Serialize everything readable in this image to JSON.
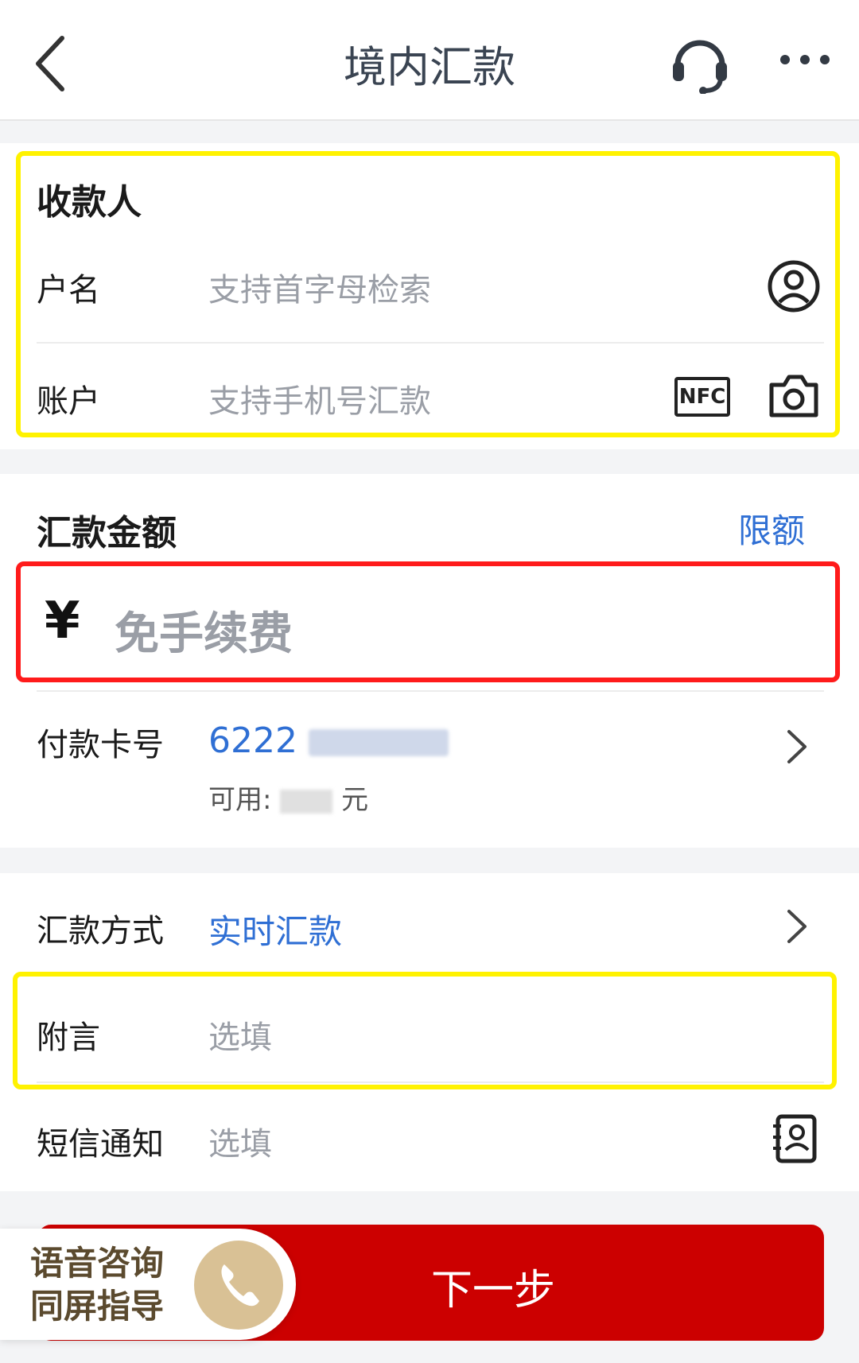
{
  "header": {
    "title": "境内汇款"
  },
  "payee": {
    "section_title": "收款人",
    "name_label": "户名",
    "name_placeholder": "支持首字母检索",
    "account_label": "账户",
    "account_placeholder": "支持手机号汇款",
    "nfc_badge": "NFC"
  },
  "amount": {
    "section_title": "汇款金额",
    "limit_link": "限额",
    "currency_symbol": "¥",
    "amount_placeholder": "免手续费"
  },
  "payment_card": {
    "label": "付款卡号",
    "card_prefix": "6222",
    "available_prefix": "可用:",
    "available_suffix": "元"
  },
  "method": {
    "label": "汇款方式",
    "value": "实时汇款"
  },
  "note": {
    "label": "附言",
    "placeholder": "选填"
  },
  "sms": {
    "label": "短信通知",
    "placeholder": "选填"
  },
  "voice_help": {
    "line1": "语音咨询",
    "line2": "同屏指导"
  },
  "next_button": "下一步",
  "colors": {
    "accent_blue": "#2f6fd4",
    "primary_red": "#cc0000",
    "highlight_yellow": "#fff200",
    "highlight_red": "#ff1b1b"
  }
}
